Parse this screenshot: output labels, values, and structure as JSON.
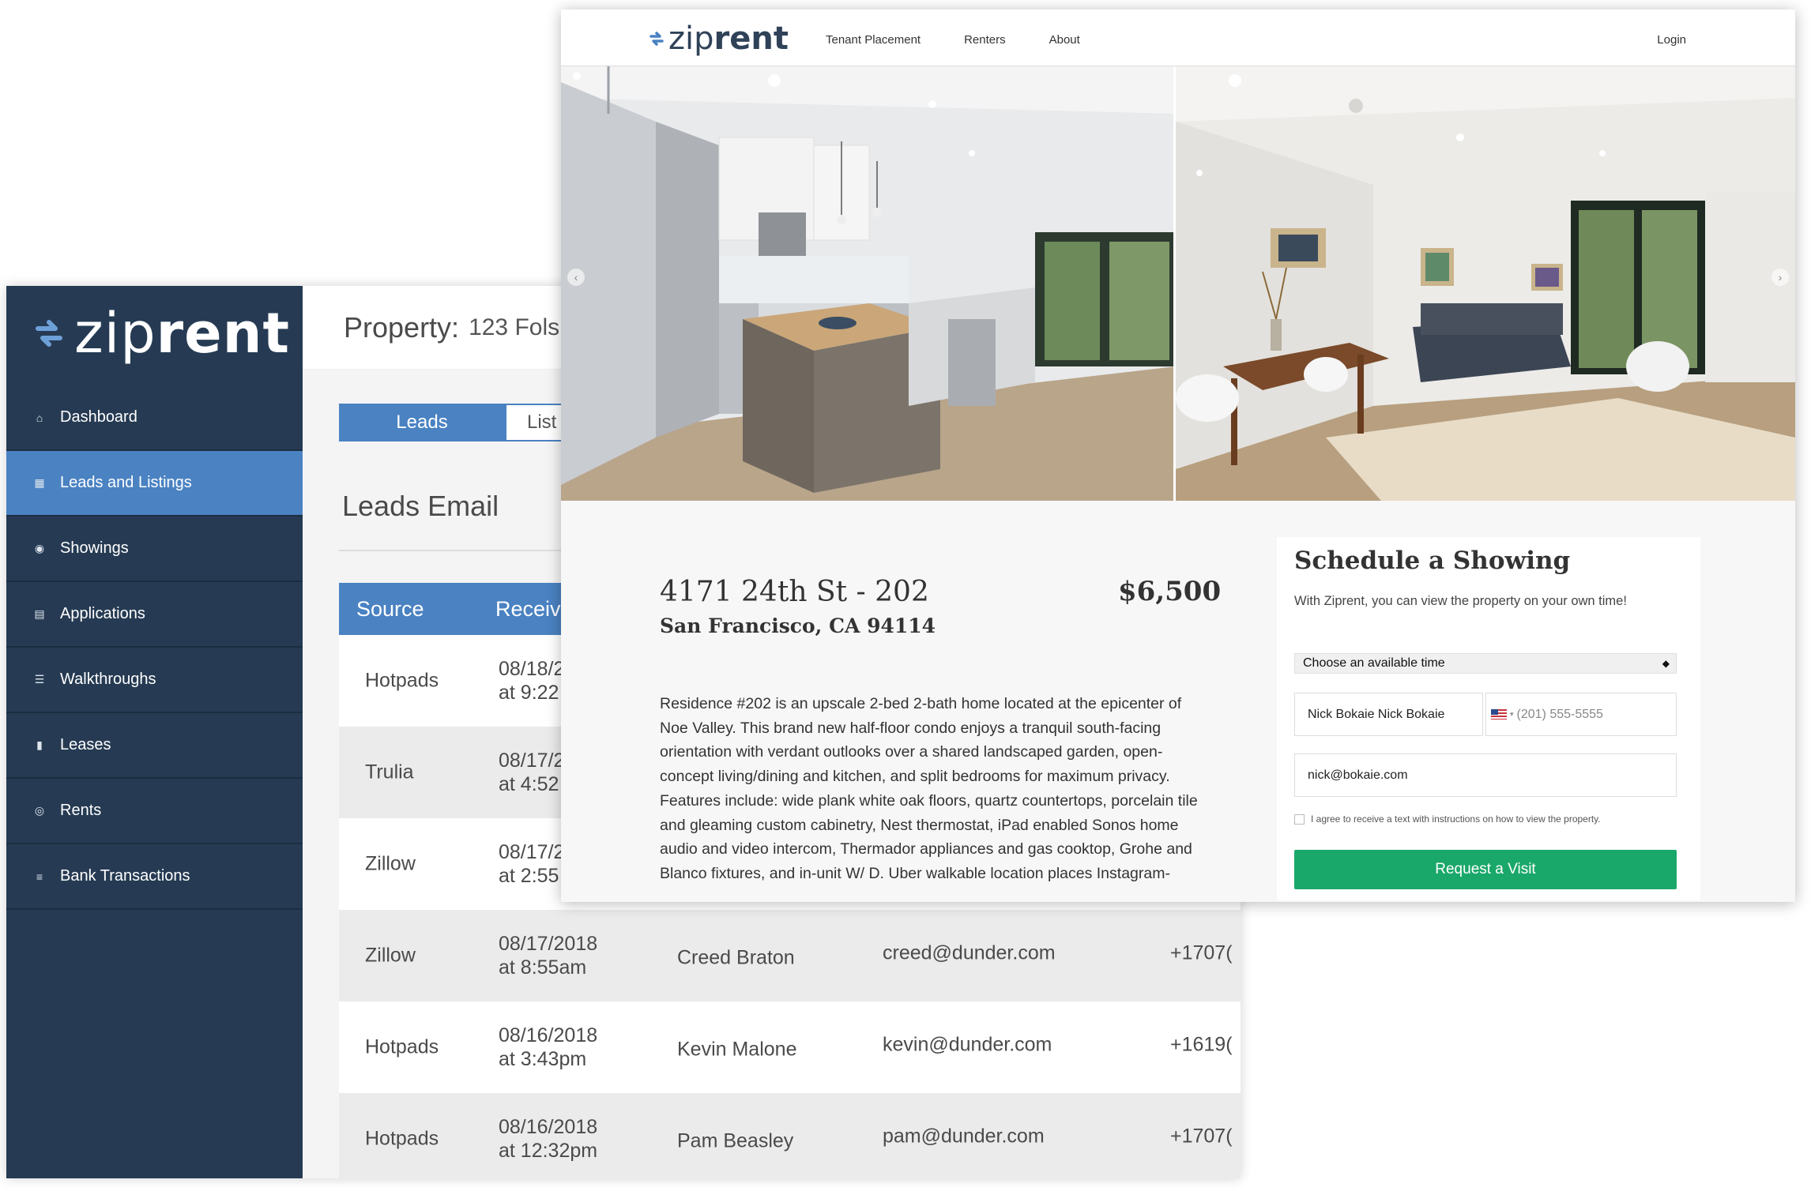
{
  "dashboard": {
    "logo": {
      "prefix": "zip",
      "suffix": "rent"
    },
    "nav": [
      {
        "label": "Dashboard",
        "icon": "home-icon"
      },
      {
        "label": "Leads and Listings",
        "icon": "document-icon"
      },
      {
        "label": "Showings",
        "icon": "eye-icon"
      },
      {
        "label": "Applications",
        "icon": "file-icon"
      },
      {
        "label": "Walkthroughs",
        "icon": "list-icon"
      },
      {
        "label": "Leases",
        "icon": "page-icon"
      },
      {
        "label": "Rents",
        "icon": "money-icon"
      },
      {
        "label": "Bank Transactions",
        "icon": "ledger-icon"
      }
    ],
    "property_label": "Property:",
    "property_value": "123 Fols",
    "tabs": {
      "leads": "Leads",
      "listings": "List"
    },
    "section_title": "Leads Email",
    "columns": {
      "source": "Source",
      "received": "Receiv"
    },
    "rows": [
      {
        "source": "Hotpads",
        "date": "08/18/2",
        "time": "at 9:22",
        "name": "",
        "email": "",
        "phone": ""
      },
      {
        "source": "Trulia",
        "date": "08/17/2",
        "time": "at 4:52",
        "name": "",
        "email": "",
        "phone": ""
      },
      {
        "source": "Zillow",
        "date": "08/17/2",
        "time": "at 2:55",
        "name": "",
        "email": "",
        "phone": ""
      },
      {
        "source": "Zillow",
        "date": "08/17/2018",
        "time": "at 8:55am",
        "name": "Creed Braton",
        "email": "creed@dunder.com",
        "phone": "+1707("
      },
      {
        "source": "Hotpads",
        "date": "08/16/2018",
        "time": "at 3:43pm",
        "name": "Kevin Malone",
        "email": "kevin@dunder.com",
        "phone": "+1619("
      },
      {
        "source": "Hotpads",
        "date": "08/16/2018",
        "time": "at 12:32pm",
        "name": "Pam Beasley",
        "email": "pam@dunder.com",
        "phone": "+1707("
      }
    ]
  },
  "site": {
    "logo": {
      "prefix": "zip",
      "suffix": "rent"
    },
    "nav": [
      "Tenant Placement",
      "Renters",
      "About"
    ],
    "login": "Login",
    "address_line1": "4171 24th St - 202",
    "address_line2": "San Francisco, CA 94114",
    "price": "$6,500",
    "description": "Residence #202 is an upscale 2-bed 2-bath home located at the epicenter of Noe Valley. This brand new half-floor condo enjoys a tranquil south-facing orientation with verdant outlooks over a shared landscaped garden, open-concept living/dining and kitchen, and split bedrooms for maximum privacy. Features include: wide plank white oak floors, quartz countertops, porcelain tile and gleaming custom cabinetry, Nest thermostat, iPad enabled Sonos home audio and video intercom, Thermador appliances and gas cooktop, Grohe and Blanco fixtures, and in-unit W/ D. Uber walkable location places Instagram-",
    "form": {
      "title": "Schedule a Showing",
      "subtitle": "With Ziprent, you can view the property on your own time!",
      "time_select": "Choose an available time",
      "name_value": "Nick Bokaie Nick Bokaie",
      "phone_placeholder": "(201) 555-5555",
      "email_value": "nick@bokaie.com",
      "consent": "I agree to receive a text with instructions on how to view the property.",
      "submit": "Request a Visit"
    }
  },
  "colors": {
    "navy": "#263b53",
    "accent_blue": "#4a82c2",
    "green": "#1aa86a"
  }
}
